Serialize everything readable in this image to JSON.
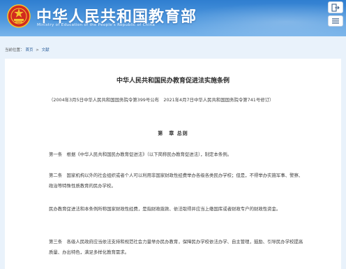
{
  "header": {
    "site_title": "中华人民共和国教育部",
    "site_subtitle": "Ministry of Education of the People's Republic of China",
    "emblem_icon": "national-emblem-icon",
    "exit_icon": "exit-icon",
    "menu_icon": "menu-icon",
    "brand_color": "#2f7ed0"
  },
  "breadcrumb": {
    "label": "当前位置：",
    "home": "首页",
    "separator": ">",
    "section": "文献"
  },
  "article": {
    "title": "中华人民共和国民办教育促进法实施条例",
    "preamble": "（2004年3月5日中华人民共和国国务院令第399号公布　2021年4月7日中华人民共和国国务院令第741号修订）",
    "chapter": "第　章 总则",
    "paragraphs": [
      "第一条　根据《中华人民共和国民办教育促进法》（以下简称民办教育促进法），制定本条例。",
      "第二条　国家机构以外的社会组织或者个人可以利用非国家财政性经费举办各级各类民办学校；但是，不得举办实施军事、警察、政治等特殊性质教育的民办学校。",
      "民办教育促进法和本条例所称国家财政性经费，是指财政拨款、依法取得并应当上缴国库或者财政专户的财政性资金。",
      "第三条　各级人民政府应当依法支持和规范社会力量举办民办教育，保障民办学校依法办学、自主管理，鼓励、引导民办学校提高质量、办出特色，满足多样化教育需求。"
    ]
  }
}
